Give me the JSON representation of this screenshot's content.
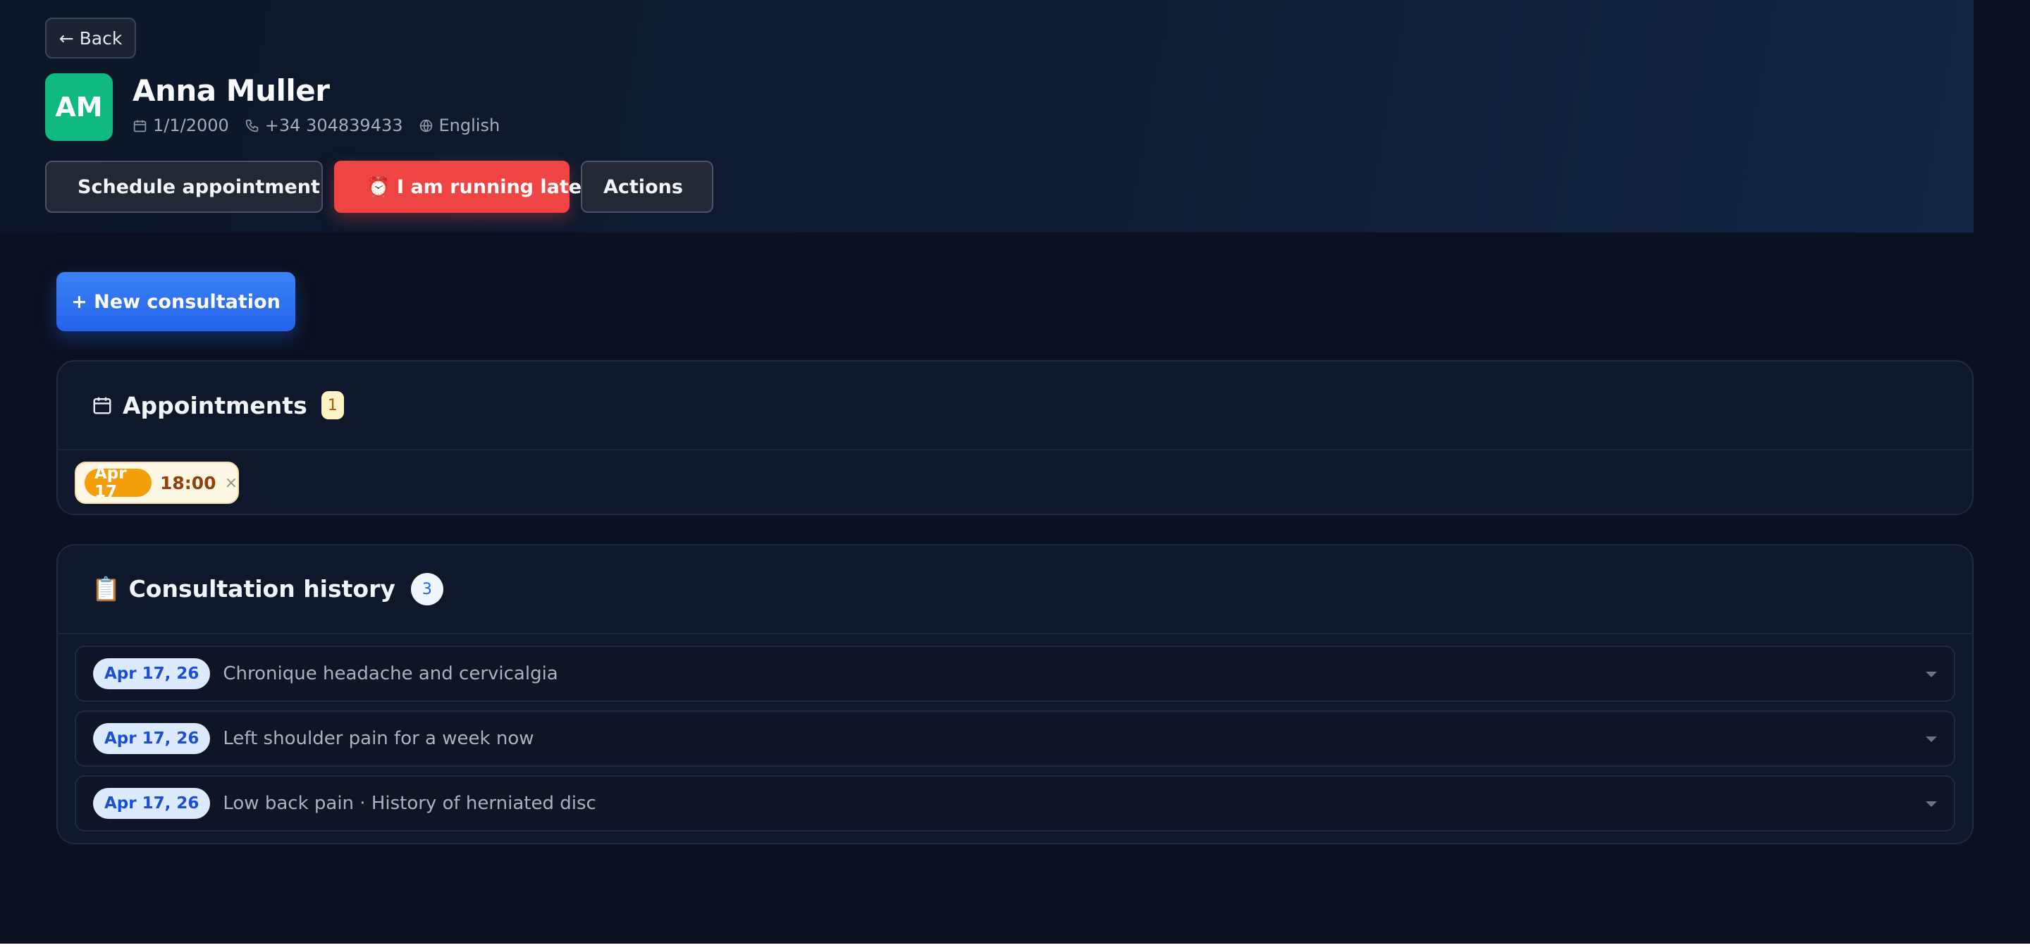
{
  "header": {
    "back_label": "← Back",
    "avatar_initials": "AM",
    "patient_name": "Anna Muller",
    "birth_date": "1/1/2000",
    "phone": "+34 304839433",
    "language": "English",
    "schedule_label": "Schedule appointment",
    "late_label": "⏰ I am running late",
    "actions_label": "Actions"
  },
  "main": {
    "new_consultation_label": "+ New consultation",
    "appointments": {
      "title": "Appointments",
      "count": "1",
      "items": [
        {
          "date": "Apr 17",
          "time": "18:00",
          "remove": "×"
        }
      ]
    },
    "history": {
      "title": "📋 Consultation history",
      "count": "3",
      "items": [
        {
          "date": "Apr 17, 26",
          "summary": "Chronique headache and cervicalgia"
        },
        {
          "date": "Apr 17, 26",
          "summary": "Left shoulder pain for a week now"
        },
        {
          "date": "Apr 17, 26",
          "summary": "Low back pain · History of herniated disc"
        }
      ]
    }
  },
  "colors": {
    "avatar": "#10b981",
    "late_button": "#ef4444",
    "primary": "#2563eb",
    "appointment_badge": "#f59e0b"
  }
}
